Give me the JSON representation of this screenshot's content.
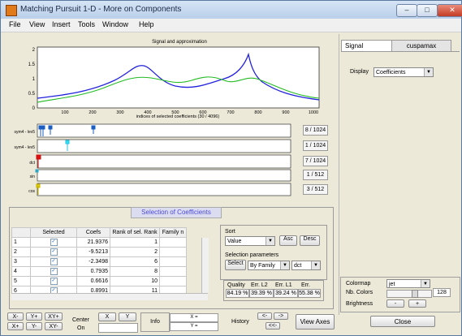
{
  "window": {
    "title": "Matching Pursuit 1-D - More on Components"
  },
  "menu": [
    "File",
    "View",
    "Insert",
    "Tools",
    "Window",
    "Help"
  ],
  "plot": {
    "title": "Signal and approximation",
    "xlabel": "indices of selected coefficients (30 / 4096)",
    "x_ticks": [
      "100",
      "200",
      "300",
      "400",
      "500",
      "600",
      "700",
      "800",
      "900",
      "1000"
    ],
    "y_ticks": [
      "2",
      "1.5",
      "1",
      "0.5",
      "0"
    ]
  },
  "rows": [
    {
      "label": "sym4 - lev5",
      "count": "8 / 1024"
    },
    {
      "label": "sym4 - lev5",
      "count": "1 / 1024"
    },
    {
      "label": "dct",
      "count": "7 / 1024"
    },
    {
      "label": "sin",
      "count": "1 / 512"
    },
    {
      "label": "cos",
      "count": "3 / 512"
    }
  ],
  "selection": {
    "title": "Selection of Coefficients",
    "columns": [
      "Selected",
      "Coefs",
      "Rank  of sel. Rank",
      "Family n"
    ],
    "rows": [
      {
        "n": "1",
        "coef": "21.9376",
        "rank": "1"
      },
      {
        "n": "2",
        "coef": "-9.5213",
        "rank": "2"
      },
      {
        "n": "3",
        "coef": "-2.3498",
        "rank": "6"
      },
      {
        "n": "4",
        "coef": "0.7935",
        "rank": "8"
      },
      {
        "n": "5",
        "coef": "0.6616",
        "rank": "10"
      },
      {
        "n": "6",
        "coef": "0.8991",
        "rank": "11"
      }
    ]
  },
  "sort": {
    "label": "Sort",
    "value": "Value",
    "asc": "Asc",
    "desc": "Desc"
  },
  "selparams": {
    "label": "Selection parameters",
    "select": "Select",
    "family": "By Family",
    "dict": "dct"
  },
  "quality": {
    "headers": [
      "Quality",
      "Err. L2",
      "Err. L1",
      "Err."
    ],
    "values": [
      "84.19 %",
      "39.39 %",
      "39.24 %",
      "55.38 %"
    ]
  },
  "right": {
    "tabs": [
      "Signal",
      "cuspamax"
    ],
    "display_label": "Display",
    "display_value": "Coefficients",
    "colormap_label": "Colormap",
    "colormap_value": "jet",
    "ncolors_label": "Nb. Colors",
    "ncolors_value": "128",
    "brightness_label": "Brightness",
    "minus": "-",
    "plus": "+",
    "close": "Close"
  },
  "bottom": {
    "xminus": "X-",
    "xplus": "X+",
    "yplus": "Y+",
    "yminus": "Y-",
    "xyplus": "XY+",
    "xyminus": "XY-",
    "center_label": "Center",
    "on": "On",
    "x_btn": "X",
    "y_btn": "Y",
    "info": "Info",
    "x_eq": "X =",
    "y_eq": "Y =",
    "history": "History",
    "back": "<-",
    "fwd": "->",
    "back2": "<<-",
    "view_axes": "View Axes"
  },
  "colors": {
    "signal": "#2222dd",
    "approx": "#22bb22",
    "accent": "#5a5adc"
  }
}
